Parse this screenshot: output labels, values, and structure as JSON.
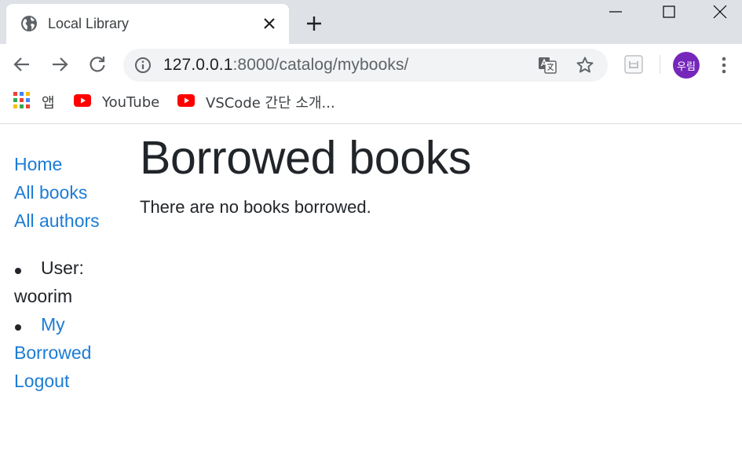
{
  "browser": {
    "tab": {
      "title": "Local Library"
    },
    "window_controls": {
      "minimize": "minimize-icon",
      "maximize": "maximize-icon",
      "close": "close-icon"
    },
    "address": {
      "host": "127.0.0.1",
      "path": ":8000/catalog/mybooks/"
    },
    "profile_initials": "우림",
    "bookmarks": [
      {
        "label": "앱",
        "icon": "apps-grid-icon"
      },
      {
        "label": "YouTube",
        "icon": "youtube-icon"
      },
      {
        "label": "VSCode 간단 소개...",
        "icon": "youtube-icon"
      }
    ],
    "colors": {
      "frame": "#dee1e6",
      "omnibox": "#f1f3f4",
      "avatar": "#7627bb",
      "youtube": "#ff0000"
    }
  },
  "page": {
    "sidebar": {
      "links": [
        {
          "label": "Home"
        },
        {
          "label": "All books"
        },
        {
          "label": "All authors"
        }
      ],
      "user_label": "User: woorim",
      "my_borrowed_label": "My Borrowed",
      "logout_label": "Logout"
    },
    "title": "Borrowed books",
    "empty_message": "There are no books borrowed.",
    "colors": {
      "link": "#1c7cd5",
      "text": "#212529"
    }
  }
}
